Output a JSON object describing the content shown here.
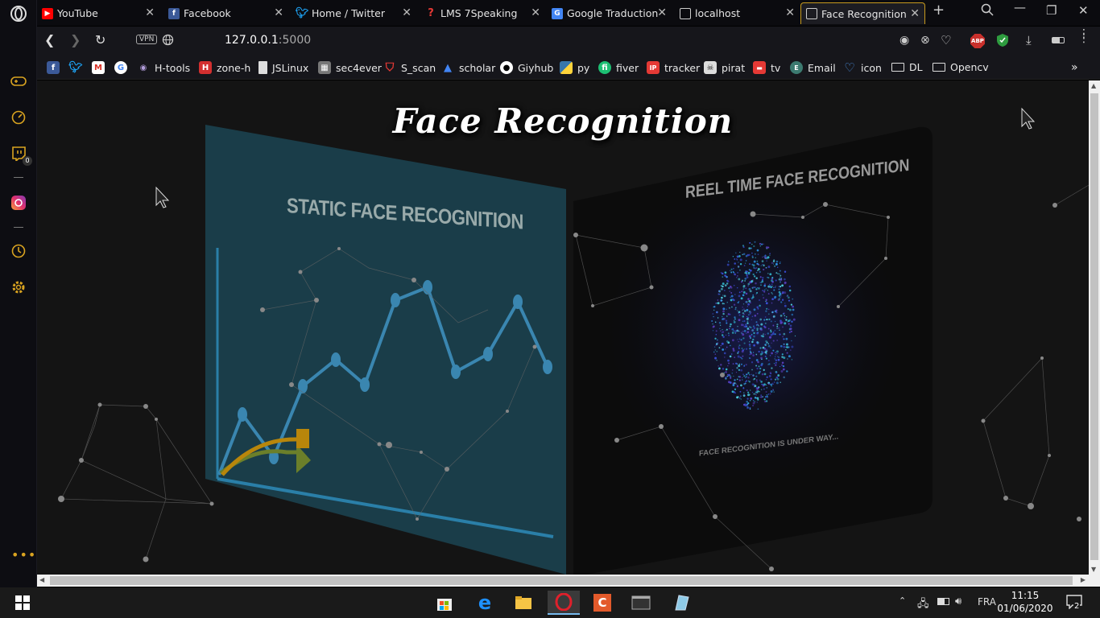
{
  "tabs": [
    {
      "label": "YouTube",
      "icon": "youtube-icon",
      "color": "#ff0000"
    },
    {
      "label": "Facebook",
      "icon": "facebook-icon",
      "color": "#3b5998"
    },
    {
      "label": "Home / Twitter",
      "icon": "twitter-icon",
      "color": "#1da1f2"
    },
    {
      "label": "LMS 7Speaking",
      "icon": "lms-icon",
      "color": "#e53935"
    },
    {
      "label": "Google Traduction",
      "icon": "google-translate-icon",
      "color": "#4285f4"
    },
    {
      "label": "localhost",
      "icon": "page-icon",
      "color": "#cccccc"
    },
    {
      "label": "Face Recognition",
      "icon": "page-icon",
      "color": "#cccccc"
    }
  ],
  "address": {
    "host": "127.0.0.1",
    "port": ":5000",
    "vpn_label": "VPN"
  },
  "bookmarks": [
    {
      "label": "",
      "icon": "facebook-icon",
      "color": "#3b5998"
    },
    {
      "label": "",
      "icon": "twitter-icon",
      "color": "#1da1f2"
    },
    {
      "label": "",
      "icon": "gmail-icon",
      "color": "#d93025"
    },
    {
      "label": "",
      "icon": "google-icon",
      "color": "#ffffff"
    },
    {
      "label": "H-tools",
      "icon": "eye-icon",
      "color": "#6a5acd"
    },
    {
      "label": "zone-h",
      "icon": "zone-h-icon",
      "color": "#d32f2f"
    },
    {
      "label": "JSLinux",
      "icon": "page-icon",
      "color": "#dddddd"
    },
    {
      "label": "sec4ever",
      "icon": "sec4ever-icon",
      "color": "#888888"
    },
    {
      "label": "S_scan",
      "icon": "shield-icon",
      "color": "#e53935"
    },
    {
      "label": "scholar",
      "icon": "scholar-icon",
      "color": "#4285f4"
    },
    {
      "label": "Giyhub",
      "icon": "github-icon",
      "color": "#ffffff"
    },
    {
      "label": "py",
      "icon": "python-icon",
      "color": "#3776ab"
    },
    {
      "label": "fiver",
      "icon": "fiverr-icon",
      "color": "#1dbf73"
    },
    {
      "label": "tracker",
      "icon": "ip-icon",
      "color": "#e53935"
    },
    {
      "label": "pirat",
      "icon": "pirate-icon",
      "color": "#dddddd"
    },
    {
      "label": "tv",
      "icon": "tv-icon",
      "color": "#e53935"
    },
    {
      "label": "Email",
      "icon": "email-icon",
      "color": "#5ab0a0"
    },
    {
      "label": "icon",
      "icon": "heart-icon",
      "color": "#4a90e2"
    },
    {
      "label": "DL",
      "icon": "folder-icon",
      "color": "#dddddd"
    },
    {
      "label": "Opencv",
      "icon": "folder-icon",
      "color": "#dddddd"
    }
  ],
  "badge": {
    "count": "0"
  },
  "extensions": {
    "abp": "ABP"
  },
  "page": {
    "title": "Face Recognition",
    "static_panel": {
      "title": "STATIC FACE RECOGNITION"
    },
    "reel_panel": {
      "title": "REEL TIME FACE RECOGNITION",
      "status": "FACE RECOGNITION IS UNDER WAY..."
    }
  },
  "taskbar": {
    "language": "FRA",
    "time": "11:15",
    "date": "01/06/2020",
    "notifications": "2"
  },
  "colors": {
    "accent": "#d9a320",
    "panel_static": "#1b4452",
    "chart_line": "#3a86b0"
  }
}
